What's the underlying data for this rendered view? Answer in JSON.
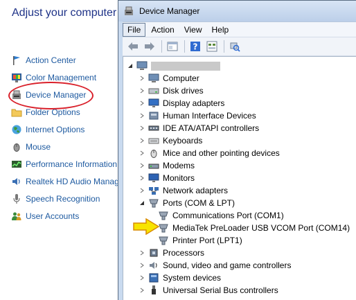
{
  "control_panel": {
    "title": "Adjust your computer",
    "items": [
      {
        "label": "Action Center",
        "icon": "flag-icon"
      },
      {
        "label": "Color Management",
        "icon": "monitor-color-icon"
      },
      {
        "label": "Device Manager",
        "icon": "device-manager-icon"
      },
      {
        "label": "Folder Options",
        "icon": "folder-options-icon"
      },
      {
        "label": "Internet Options",
        "icon": "globe-icon"
      },
      {
        "label": "Mouse",
        "icon": "mouse-icon"
      },
      {
        "label": "Performance Information",
        "icon": "performance-icon"
      },
      {
        "label": "Realtek HD Audio Manag",
        "icon": "audio-icon"
      },
      {
        "label": "Speech Recognition",
        "icon": "microphone-icon"
      },
      {
        "label": "User Accounts",
        "icon": "users-icon"
      }
    ]
  },
  "device_manager": {
    "title": "Device Manager",
    "menu": [
      "File",
      "Action",
      "View",
      "Help"
    ],
    "toolbar": [
      "back-arrow-icon",
      "forward-arrow-icon",
      "properties-icon",
      "help-icon",
      "show-hidden-icon",
      "scan-hardware-icon"
    ],
    "tree": {
      "root": {
        "label": "",
        "icon": "computer-icon"
      },
      "nodes": [
        {
          "label": "Computer",
          "expanded": false
        },
        {
          "label": "Disk drives",
          "expanded": false
        },
        {
          "label": "Display adapters",
          "expanded": false
        },
        {
          "label": "Human Interface Devices",
          "expanded": false
        },
        {
          "label": "IDE ATA/ATAPI controllers",
          "expanded": false
        },
        {
          "label": "Keyboards",
          "expanded": false
        },
        {
          "label": "Mice and other pointing devices",
          "expanded": false
        },
        {
          "label": "Modems",
          "expanded": false
        },
        {
          "label": "Monitors",
          "expanded": false
        },
        {
          "label": "Network adapters",
          "expanded": false
        },
        {
          "label": "Ports (COM & LPT)",
          "expanded": true,
          "children": [
            "Communications Port (COM1)",
            "MediaTek PreLoader USB VCOM Port (COM14)",
            "Printer Port (LPT1)"
          ]
        },
        {
          "label": "Processors",
          "expanded": false
        },
        {
          "label": "Sound, video and game controllers",
          "expanded": false
        },
        {
          "label": "System devices",
          "expanded": false
        },
        {
          "label": "Universal Serial Bus controllers",
          "expanded": false
        }
      ]
    }
  },
  "colors": {
    "link": "#1e5aa0",
    "highlight_circle": "#d9202a",
    "arrow_fill": "#f7e400",
    "arrow_stroke": "#d98b00"
  }
}
